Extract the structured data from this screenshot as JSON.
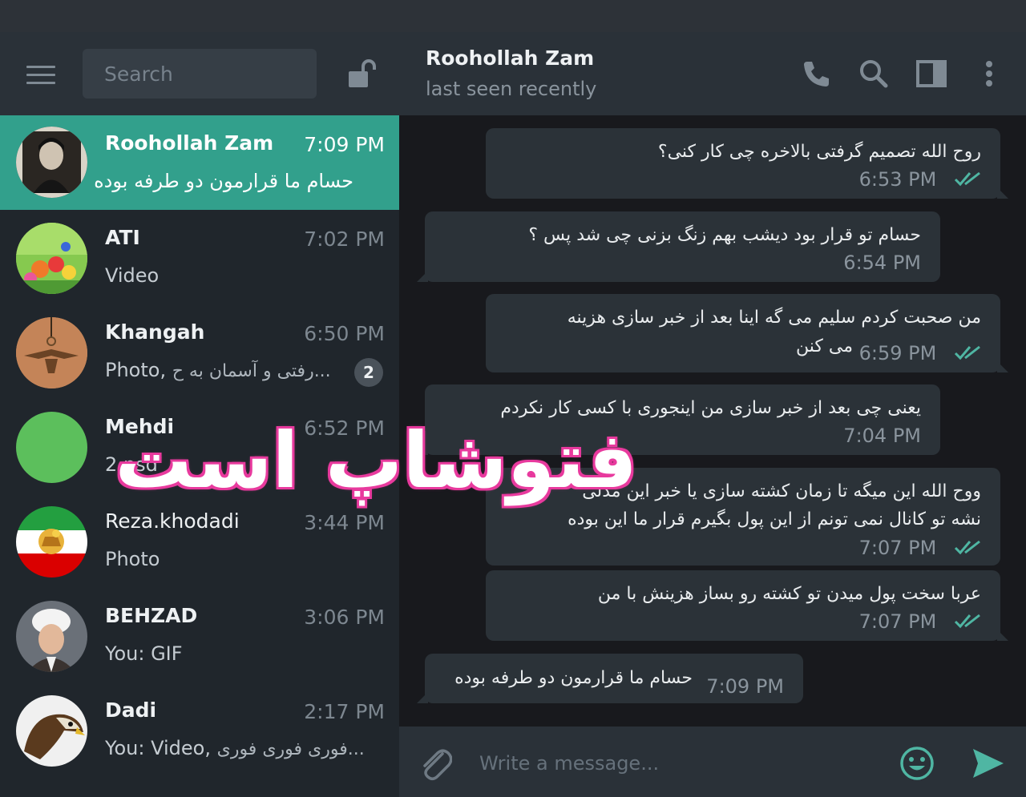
{
  "sidebar": {
    "search_placeholder": "Search",
    "chats": [
      {
        "name": "Roohollah Zam",
        "time": "7:09 PM",
        "preview": "حسام ما قرارمون دو طرفه بوده"
      },
      {
        "name": "ATI",
        "time": "7:02 PM",
        "preview": "Video"
      },
      {
        "name": "Khangah",
        "time": "6:50 PM",
        "preview_prefix": "Photo,",
        "preview_rtl": "...رفتی و آسمان به ح",
        "unread": "2"
      },
      {
        "name": "Mehdi",
        "time": "6:52 PM",
        "preview": "2.psd"
      },
      {
        "name": "Reza.khodadi",
        "time": "3:44 PM",
        "preview": "Photo"
      },
      {
        "name": "BEHZAD",
        "time": "3:06 PM",
        "preview": "You: GIF"
      },
      {
        "name": "Dadi",
        "time": "2:17 PM",
        "preview_prefix": "You: Video,",
        "preview_rtl": "...فوری فوری فوری"
      }
    ]
  },
  "header": {
    "peer_name": "Roohollah Zam",
    "peer_status": "last seen recently"
  },
  "messages": [
    {
      "dir": "out",
      "lines": [
        "روح الله تصمیم  گرفتی بالاخره چی کار کنی؟"
      ],
      "time": "6:53 PM"
    },
    {
      "dir": "in",
      "lines": [
        "حسام تو قرار بود دیشب بهم زنگ بزنی چی شد پس ؟"
      ],
      "time": "6:54 PM"
    },
    {
      "dir": "out",
      "lines": [
        "من صحبت کردم سلیم می گه اینا بعد از خبر سازی  هزینه",
        "می کنن"
      ],
      "time": "6:59 PM"
    },
    {
      "dir": "in",
      "lines": [
        "یعنی چی بعد از خبر سازی من اینجوری با کسی کار نکردم"
      ],
      "time": "7:04 PM"
    },
    {
      "dir": "out",
      "lines": [
        "ووح الله این میگه تا زمان کشته سازی یا خبر این مدلی",
        "نشه تو کانال نمی تونم از این پول بگیرم قرار ما این بوده"
      ],
      "time": "7:07 PM"
    },
    {
      "dir": "out",
      "lines": [
        "عربا سخت پول میدن تو کشته رو بساز هزینش با من"
      ],
      "time": "7:07 PM"
    },
    {
      "dir": "in",
      "lines": [
        "حسام ما قرارمون دو طرفه بوده"
      ],
      "time": "7:09 PM"
    }
  ],
  "composer": {
    "placeholder": "Write a message..."
  },
  "watermark": "فتوشاپ است",
  "colors": {
    "accent": "#32a08c",
    "sidebar_bg": "#20262c",
    "header_bg": "#2a3138",
    "chat_bg": "#18191d",
    "bubble_bg": "#2b3238",
    "read_check": "#4fb6a3",
    "watermark_outline": "#e83b9e"
  },
  "icons": {
    "menu": "hamburger-icon",
    "lock": "unlock-icon",
    "call": "phone-icon",
    "search": "search-icon",
    "sidebar_toggle": "columns-icon",
    "more": "more-vertical-icon",
    "attach": "paperclip-icon",
    "emoji": "smile-icon",
    "send": "send-icon"
  }
}
